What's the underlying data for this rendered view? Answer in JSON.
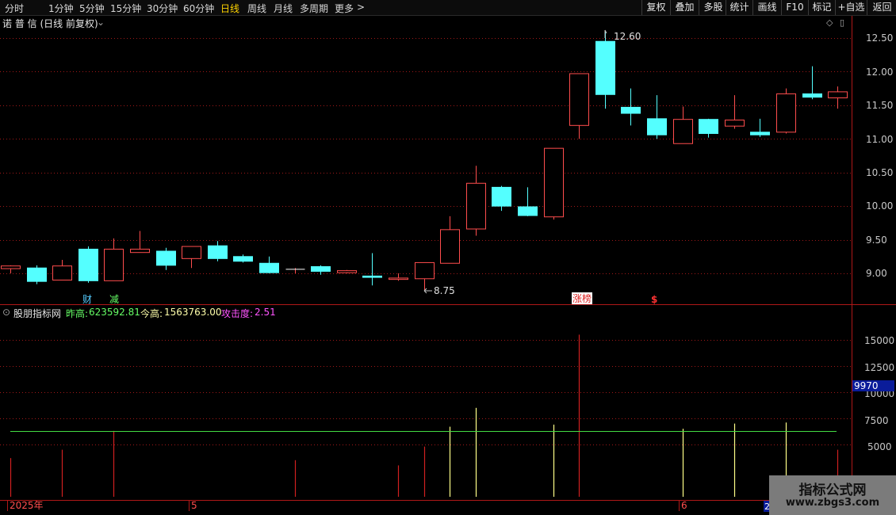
{
  "toolbar": {
    "tabs": [
      "分时",
      "1分钟",
      "5分钟",
      "15分钟",
      "30分钟",
      "60分钟",
      "日线",
      "周线",
      "月线",
      "多周期",
      "更多"
    ],
    "active_tab": "日线",
    "right_buttons": [
      "复权",
      "叠加",
      "多股",
      "统计",
      "画线",
      "F10",
      "标记",
      "+自选",
      "返回"
    ]
  },
  "main": {
    "title": "诺 普 信 (日线 前复权)",
    "y_ticks": [
      "12.50",
      "12.00",
      "11.50",
      "11.00",
      "10.50",
      "10.00",
      "9.50",
      "9.00"
    ],
    "high_label": "12.60",
    "low_label": "8.75",
    "markers": {
      "cai": "财",
      "jian": "减",
      "zhangbang": "涨榜",
      "dollar": "$"
    }
  },
  "sub": {
    "name": "股朋指标网",
    "yesterday_label": "昨高:",
    "yesterday_value": "623592.81",
    "today_label": "今高:",
    "today_value": "1563763.00",
    "attack_label": "攻击度:",
    "attack_value": "2.51",
    "y_ticks": [
      "15000",
      "12500",
      "10000",
      "7500",
      "5000"
    ],
    "current_value": "9970",
    "threshold_line": 6300
  },
  "date_axis": {
    "labels": [
      "2025年",
      "5",
      "6",
      "2"
    ]
  },
  "watermark": {
    "title": "指标公式网",
    "url": "www.zbgs3.com"
  },
  "colors": {
    "up": "#ff4d4d",
    "down": "#54ffff",
    "signal": "#ffff88",
    "threshold": "#44dd44",
    "accent": "#ffd400"
  },
  "chart_data": {
    "type": "candlestick",
    "candles": [
      {
        "o": 9.07,
        "c": 9.11,
        "h": 9.12,
        "l": 9.0
      },
      {
        "o": 9.08,
        "c": 8.88,
        "h": 9.12,
        "l": 8.84
      },
      {
        "o": 8.9,
        "c": 9.11,
        "h": 9.2,
        "l": 8.9
      },
      {
        "o": 9.36,
        "c": 8.89,
        "h": 9.4,
        "l": 8.86
      },
      {
        "o": 8.89,
        "c": 9.36,
        "h": 9.52,
        "l": 8.89
      },
      {
        "o": 9.31,
        "c": 9.36,
        "h": 9.63,
        "l": 9.31
      },
      {
        "o": 9.33,
        "c": 9.12,
        "h": 9.38,
        "l": 9.05
      },
      {
        "o": 9.22,
        "c": 9.4,
        "h": 9.4,
        "l": 9.08
      },
      {
        "o": 9.41,
        "c": 9.22,
        "h": 9.48,
        "l": 9.18
      },
      {
        "o": 9.25,
        "c": 9.18,
        "h": 9.28,
        "l": 9.16
      },
      {
        "o": 9.15,
        "c": 9.01,
        "h": 9.25,
        "l": 9.0
      },
      {
        "o": 9.06,
        "c": 9.06,
        "h": 9.08,
        "l": 9.0
      },
      {
        "o": 9.1,
        "c": 9.03,
        "h": 9.12,
        "l": 8.98
      },
      {
        "o": 9.01,
        "c": 9.04,
        "h": 9.05,
        "l": 9.0
      },
      {
        "o": 8.96,
        "c": 8.94,
        "h": 9.3,
        "l": 8.82
      },
      {
        "o": 8.91,
        "c": 8.93,
        "h": 9.0,
        "l": 8.89
      },
      {
        "o": 8.92,
        "c": 9.16,
        "h": 9.16,
        "l": 8.75
      },
      {
        "o": 9.15,
        "c": 9.65,
        "h": 9.85,
        "l": 9.15
      },
      {
        "o": 9.66,
        "c": 10.34,
        "h": 10.6,
        "l": 9.56
      },
      {
        "o": 10.28,
        "c": 10.0,
        "h": 10.3,
        "l": 9.93
      },
      {
        "o": 9.99,
        "c": 9.86,
        "h": 10.28,
        "l": 9.85
      },
      {
        "o": 9.84,
        "c": 10.86,
        "h": 10.86,
        "l": 9.8
      },
      {
        "o": 11.2,
        "c": 11.97,
        "h": 11.97,
        "l": 11.0
      },
      {
        "o": 12.45,
        "c": 11.66,
        "h": 12.6,
        "l": 11.45
      },
      {
        "o": 11.47,
        "c": 11.38,
        "h": 11.75,
        "l": 11.2
      },
      {
        "o": 11.3,
        "c": 11.06,
        "h": 11.65,
        "l": 11.0
      },
      {
        "o": 10.93,
        "c": 11.29,
        "h": 11.48,
        "l": 10.93
      },
      {
        "o": 11.29,
        "c": 11.08,
        "h": 11.3,
        "l": 11.02
      },
      {
        "o": 11.19,
        "c": 11.28,
        "h": 11.65,
        "l": 11.15
      },
      {
        "o": 11.1,
        "c": 11.06,
        "h": 11.3,
        "l": 11.03
      },
      {
        "o": 11.1,
        "c": 11.67,
        "h": 11.75,
        "l": 11.08
      },
      {
        "o": 11.67,
        "c": 11.62,
        "h": 12.08,
        "l": 11.59
      },
      {
        "o": 11.61,
        "c": 11.7,
        "h": 11.78,
        "l": 11.45
      }
    ],
    "indicator": [
      {
        "i": 0,
        "v": 3700,
        "c": "r"
      },
      {
        "i": 2,
        "v": 4500,
        "c": "r"
      },
      {
        "i": 4,
        "v": 6300,
        "c": "r"
      },
      {
        "i": 11,
        "v": 3500,
        "c": "r"
      },
      {
        "i": 15,
        "v": 3000,
        "c": "r"
      },
      {
        "i": 16,
        "v": 4800,
        "c": "r"
      },
      {
        "i": 17,
        "v": 6700,
        "c": "y"
      },
      {
        "i": 18,
        "v": 8500,
        "c": "y"
      },
      {
        "i": 21,
        "v": 6900,
        "c": "y"
      },
      {
        "i": 22,
        "v": 15500,
        "c": "r"
      },
      {
        "i": 26,
        "v": 6500,
        "c": "y"
      },
      {
        "i": 28,
        "v": 7000,
        "c": "y"
      },
      {
        "i": 30,
        "v": 7100,
        "c": "y"
      },
      {
        "i": 32,
        "v": 4500,
        "c": "r"
      }
    ],
    "ylim": [
      8.6,
      12.65
    ],
    "sub_ylim": [
      2000,
      17000
    ]
  }
}
